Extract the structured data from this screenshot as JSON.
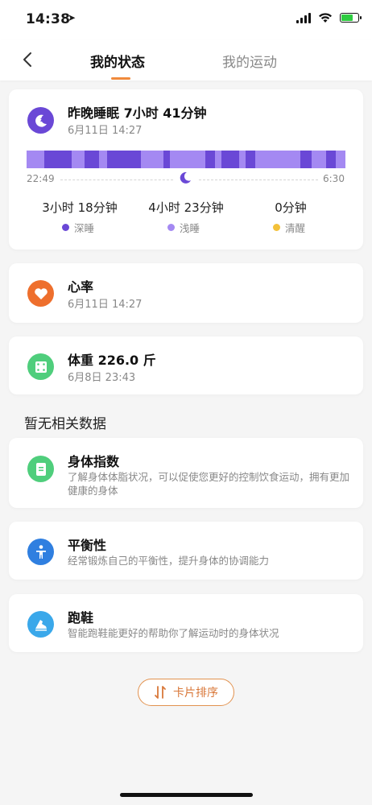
{
  "status_bar": {
    "time": "14:38"
  },
  "nav": {
    "tabs": [
      {
        "label": "我的状态",
        "active": true
      },
      {
        "label": "我的运动",
        "active": false
      }
    ]
  },
  "sleep": {
    "title": "昨晚睡眠 7小时 41分钟",
    "date": "6月11日 14:27",
    "start_time": "22:49",
    "end_time": "6:30",
    "stats": [
      {
        "value": "3小时 18分钟",
        "label": "深睡",
        "color": "#6a48d6"
      },
      {
        "value": "4小时 23分钟",
        "label": "浅睡",
        "color": "#a489f2"
      },
      {
        "value": "0分钟",
        "label": "清醒",
        "color": "#f3c13a"
      }
    ]
  },
  "heart_rate": {
    "title": "心率",
    "date": "6月11日 14:27",
    "color": "#ee6f2d"
  },
  "weight": {
    "title": "体重 226.0 斤",
    "date": "6月8日 23:43",
    "color": "#4fce7c"
  },
  "no_data_title": "暂无相关数据",
  "body_index": {
    "title": "身体指数",
    "desc": "了解身体体脂状况，可以促使您更好的控制饮食运动，拥有更加健康的身体",
    "color": "#4fce7c"
  },
  "balance": {
    "title": "平衡性",
    "desc": "经常锻炼自己的平衡性，提升身体的协调能力",
    "color": "#2f7fe0"
  },
  "shoes": {
    "title": "跑鞋",
    "desc": "智能跑鞋能更好的帮助你了解运动时的身体状况",
    "color": "#3aa8ea"
  },
  "sort_button": {
    "label": "卡片排序"
  },
  "colors": {
    "accent": "#f08a3c",
    "deep_sleep": "#6a48d6",
    "light_sleep": "#a489f2",
    "awake": "#f3c13a"
  }
}
